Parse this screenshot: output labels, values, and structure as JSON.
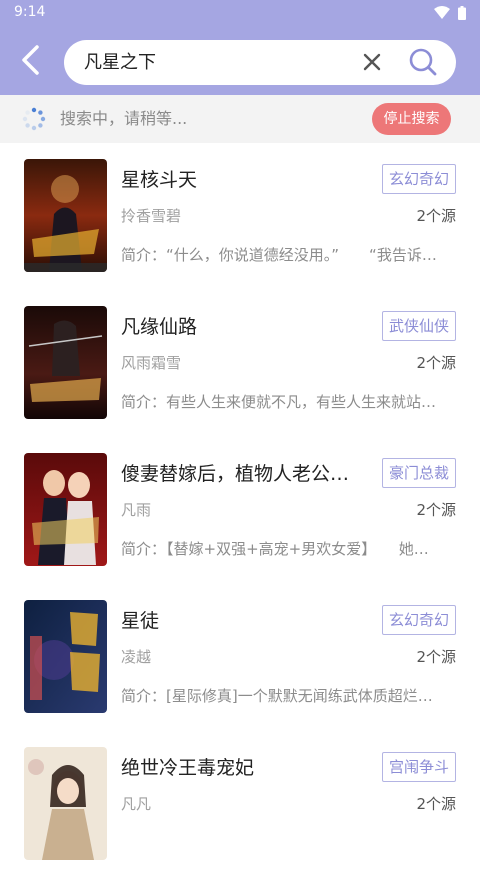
{
  "status": {
    "time": "9:14"
  },
  "search": {
    "query": "凡星之下"
  },
  "progress": {
    "text": "搜索中，请稍等...",
    "stop_label": "停止搜索"
  },
  "colors": {
    "header": "#a5a6e2",
    "accent": "#8c8dd6",
    "stop": "#ed7778"
  },
  "icons": {
    "back": "back-arrow-icon",
    "clear": "close-icon",
    "search": "search-icon",
    "loading": "loading-spinner-icon",
    "wifi": "wifi-icon",
    "battery": "battery-icon"
  },
  "books": [
    {
      "title": "星核斗天",
      "tag": "玄幻奇幻",
      "author": "拎香雪碧",
      "sources": "2个源",
      "intro": "简介：“什么，你说道德经没用。”　　“我告诉…"
    },
    {
      "title": "凡缘仙路",
      "tag": "武侠仙侠",
      "author": "风雨霜雪",
      "sources": "2个源",
      "intro": "简介：有些人生来便就不凡，有些人生来就站…"
    },
    {
      "title": "傻妻替嫁后，植物人老公…",
      "tag": "豪门总裁",
      "author": "凡雨",
      "sources": "2个源",
      "intro": "简介：【替嫁+双强+高宠+男欢女爱】　　她…"
    },
    {
      "title": "星徒",
      "tag": "玄幻奇幻",
      "author": "凌越",
      "sources": "2个源",
      "intro": "简介：[星际修真]一个默默无闻练武体质超烂…"
    },
    {
      "title": "绝世冷王毒宠妃",
      "tag": "宫闱争斗",
      "author": "凡凡",
      "sources": "2个源",
      "intro": ""
    }
  ]
}
